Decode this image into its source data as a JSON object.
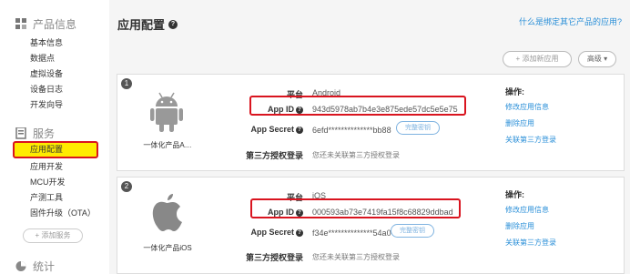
{
  "sidebar": {
    "sections": [
      {
        "label": "产品信息",
        "icon": "grid-icon"
      },
      {
        "label": "服务",
        "icon": "service-icon"
      },
      {
        "label": "统计",
        "icon": "pie-chart-icon"
      }
    ],
    "product_items": [
      "基本信息",
      "数据点",
      "虚拟设备",
      "设备日志",
      "开发向导"
    ],
    "service_items": [
      "应用配置",
      "应用开发",
      "MCU开发",
      "产测工具",
      "固件升级（OTA）"
    ],
    "add_service": "+ 添加服务"
  },
  "header": {
    "title": "应用配置",
    "help_link": "什么是绑定其它产品的应用?"
  },
  "toolbar": {
    "add_app": "+ 添加新应用",
    "advanced": "高级 ▾"
  },
  "labels": {
    "platform": "平台",
    "app_id": "App ID",
    "app_secret": "App Secret",
    "third_party_login": "第三方授权登录",
    "ops_title": "操作:",
    "copy_key": "完整密钥"
  },
  "apps": [
    {
      "index": "1",
      "logo": "android-icon",
      "name": "一体化产品A…",
      "platform": "Android",
      "app_id": "943d5978ab7b4e3e875ede57dc5e5e75",
      "app_secret": "6efd**************bb88",
      "third_party": "您还未关联第三方授权登录",
      "ops": [
        "修改应用信息",
        "删除应用",
        "关联第三方登录"
      ]
    },
    {
      "index": "2",
      "logo": "apple-icon",
      "name": "一体化产品iOS",
      "platform": "iOS",
      "app_id": "000593ab73e7419fa15f8c68829ddbad",
      "app_secret": "f34e**************54a0",
      "third_party": "您还未关联第三方授权登录",
      "ops": [
        "修改应用信息",
        "删除应用",
        "关联第三方登录"
      ]
    }
  ],
  "colors": {
    "link": "#2a8fd8",
    "highlight_border": "#d9141f",
    "active_bg": "#ffeb00"
  }
}
